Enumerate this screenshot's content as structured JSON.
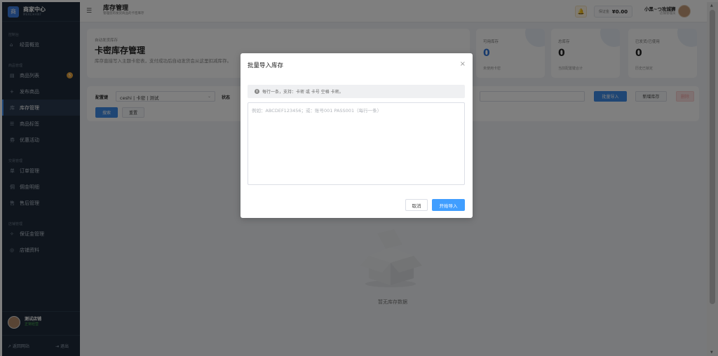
{
  "sidebar": {
    "logo_glyph": "商",
    "brand": "商家中心",
    "brand_sub": "MERCHANT",
    "groups": [
      "控制台",
      "商品管理",
      "交易管理",
      "店铺管理"
    ],
    "items": [
      {
        "icon": "home-icon",
        "glyph": "⌂",
        "label": "经营概览"
      },
      {
        "icon": "list-icon",
        "glyph": "▤",
        "label": "商品列表",
        "badge": "5"
      },
      {
        "icon": "plus-icon",
        "glyph": "+",
        "label": "发布商品"
      },
      {
        "icon": "inventory-icon",
        "glyph": "库",
        "label": "库存管理",
        "active": true
      },
      {
        "icon": "tag-icon",
        "glyph": "☰",
        "label": "商品标签"
      },
      {
        "icon": "coupon-icon",
        "glyph": "券",
        "label": "优惠活动"
      },
      {
        "icon": "order-icon",
        "glyph": "单",
        "label": "订单管理"
      },
      {
        "icon": "commission-icon",
        "glyph": "佣",
        "label": "佣金明细"
      },
      {
        "icon": "aftersale-icon",
        "glyph": "售",
        "label": "售后管理"
      },
      {
        "icon": "deposit-icon",
        "glyph": "✧",
        "label": "保证金管理"
      },
      {
        "icon": "store-icon",
        "glyph": "◎",
        "label": "店铺资料"
      }
    ],
    "shop_name": "测试店铺",
    "shop_status": "正常经营",
    "back_link": "↗ 返回网站",
    "logout": "⇥ 退出"
  },
  "topbar": {
    "title": "库存管理",
    "subtitle": "管理您的发货商品的卡密库存",
    "deposit_label": "保证金",
    "deposit_value": "¥0.00",
    "user_name": "小黑~つ攻城狮",
    "user_role": "店铺管理员"
  },
  "hero": {
    "kicker": "自动发货库存",
    "title": "卡密库存管理",
    "desc": "库存直接写入主题卡密表，支付成功后自动发货会从这里扣减库存。"
  },
  "stats": [
    {
      "label": "可用库存",
      "value": "0",
      "sub": "未使用卡密"
    },
    {
      "label": "总库存",
      "value": "0",
      "sub": "当前配置键合计"
    },
    {
      "label": "已发货/已使用",
      "value": "0",
      "sub": "历史已锁定"
    }
  ],
  "filter": {
    "config_label": "配置键",
    "config_value": "ceshi | 卡密 | 测试",
    "status_label": "状态",
    "search_btn": "搜索",
    "reset_btn": "重置",
    "import_btn": "批量导入",
    "new_btn": "新增库存",
    "delete_btn": "删除"
  },
  "empty": {
    "text": "暂无库存数据"
  },
  "modal": {
    "title": "批量导入库存",
    "close": "×",
    "tip": "每行一条，支持：卡密 或 卡号 空格 卡密。",
    "placeholder": "例如：ABCDEF123456；或：账号001 PASS001（每行一条）",
    "cancel": "取消",
    "confirm": "开始导入"
  },
  "colors": {
    "accent": "#409eff",
    "sidebar_bg": "#1e2b3a",
    "stat_value_blue": "#2f74d8"
  }
}
